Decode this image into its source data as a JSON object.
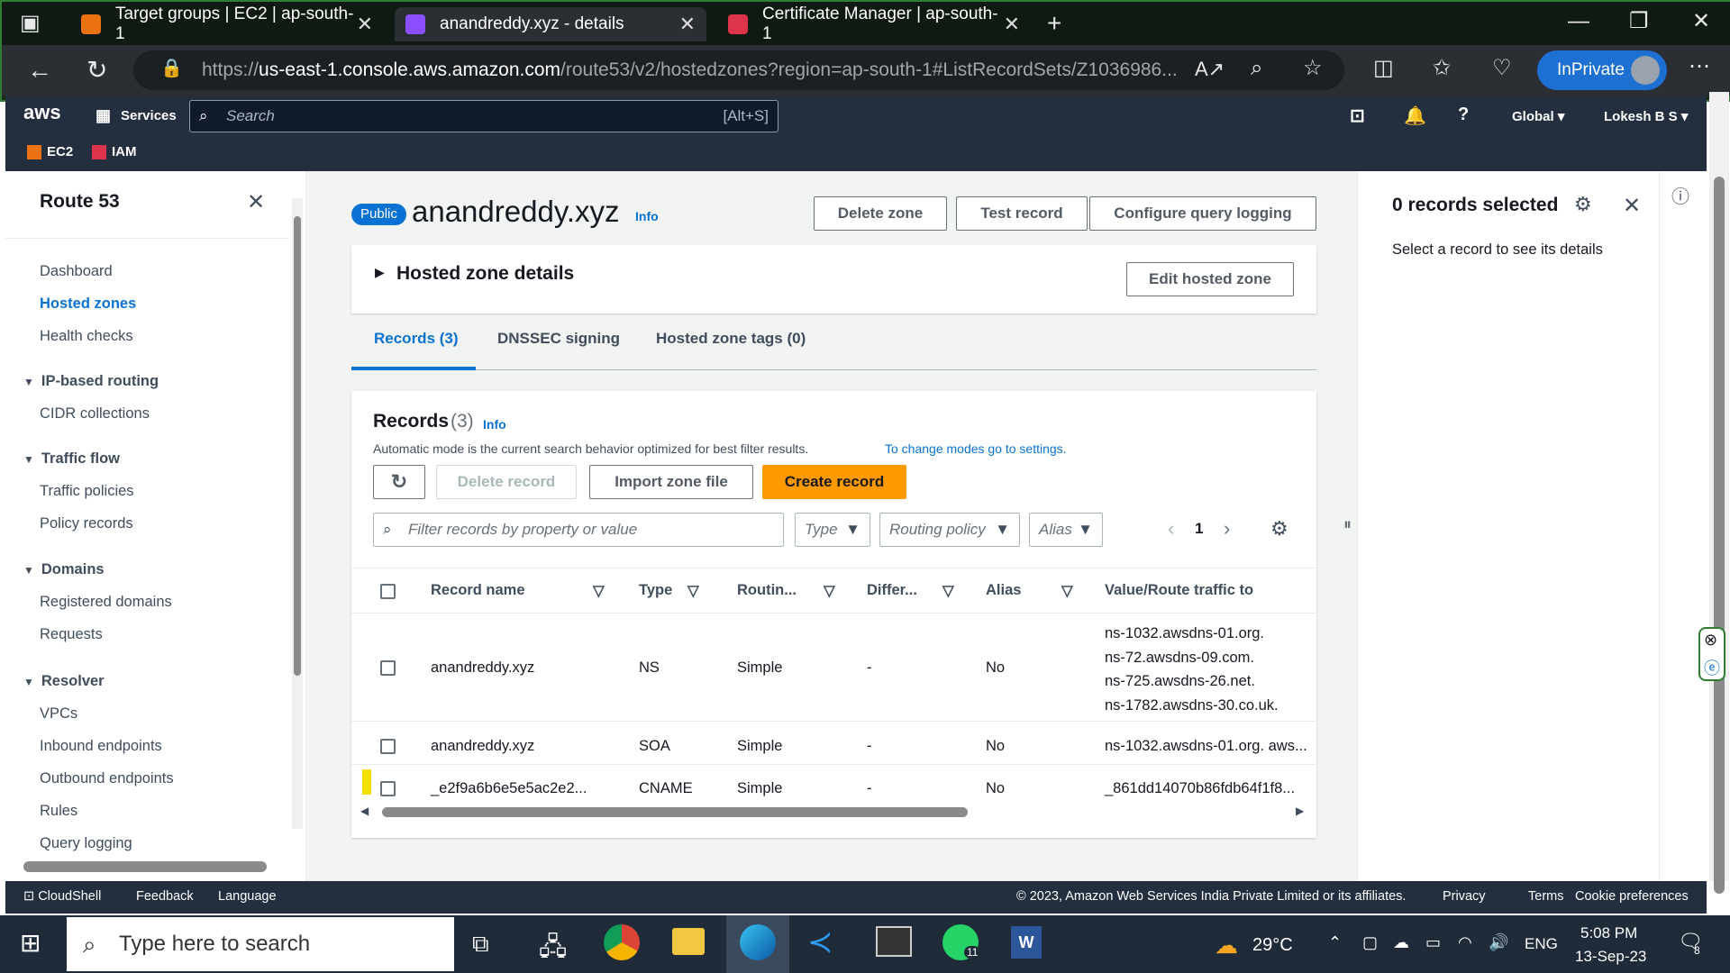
{
  "browser": {
    "tabs": [
      {
        "title": "Target groups | EC2 | ap-south-1",
        "color": "#ec7211"
      },
      {
        "title": "anandreddy.xyz - details",
        "color": "#8c4fff"
      },
      {
        "title": "Certificate Manager | ap-south-1",
        "color": "#dd344c"
      }
    ],
    "url_prefix": "https://",
    "url_host": "us-east-1.console.aws.amazon.com",
    "url_path": "/route53/v2/hostedzones?region=ap-south-1#ListRecordSets/Z1036986...",
    "inprivate": "InPrivate"
  },
  "aws_nav": {
    "logo": "aws",
    "services": "Services",
    "search_placeholder": "Search",
    "search_shortcut": "[Alt+S]",
    "region": "Global",
    "user": "Lokesh B S",
    "favorites": [
      "EC2",
      "IAM"
    ]
  },
  "sidebar": {
    "title": "Route 53",
    "items": [
      {
        "label": "Dashboard"
      },
      {
        "label": "Hosted zones",
        "active": true
      },
      {
        "label": "Health checks"
      }
    ],
    "sections": [
      {
        "title": "IP-based routing",
        "items": [
          "CIDR collections"
        ]
      },
      {
        "title": "Traffic flow",
        "items": [
          "Traffic policies",
          "Policy records"
        ]
      },
      {
        "title": "Domains",
        "items": [
          "Registered domains",
          "Requests"
        ]
      },
      {
        "title": "Resolver",
        "items": [
          "VPCs",
          "Inbound endpoints",
          "Outbound endpoints",
          "Rules",
          "Query logging"
        ]
      }
    ]
  },
  "header": {
    "badge": "Public",
    "zone_name": "anandreddy.xyz",
    "info": "Info",
    "delete_zone": "Delete zone",
    "test_record": "Test record",
    "configure_logging": "Configure query logging",
    "details_title": "Hosted zone details",
    "edit_zone": "Edit hosted zone"
  },
  "tabs": [
    "Records (3)",
    "DNSSEC signing",
    "Hosted zone tags (0)"
  ],
  "records": {
    "title": "Records",
    "count": "(3)",
    "info": "Info",
    "description": "Automatic mode is the current search behavior optimized for best filter results.",
    "settings_link": "To change modes go to settings.",
    "delete_record": "Delete record",
    "import_zone": "Import zone file",
    "create_record": "Create record",
    "filter_placeholder": "Filter records by property or value",
    "type_filter": "Type",
    "routing_filter": "Routing policy",
    "alias_filter": "Alias",
    "page": "1",
    "columns": [
      "Record name",
      "Type",
      "Routin...",
      "Differ...",
      "Alias",
      "Value/Route traffic to"
    ],
    "rows": [
      {
        "name": "anandreddy.xyz",
        "type": "NS",
        "routing": "Simple",
        "differ": "-",
        "alias": "No",
        "values": [
          "ns-1032.awsdns-01.org.",
          "ns-72.awsdns-09.com.",
          "ns-725.awsdns-26.net.",
          "ns-1782.awsdns-30.co.uk."
        ]
      },
      {
        "name": "anandreddy.xyz",
        "type": "SOA",
        "routing": "Simple",
        "differ": "-",
        "alias": "No",
        "values": [
          "ns-1032.awsdns-01.org. aws..."
        ]
      },
      {
        "name": "_e2f9a6b6e5e5ac2e2...",
        "type": "CNAME",
        "routing": "Simple",
        "differ": "-",
        "alias": "No",
        "values": [
          "_861dd14070b86fdb64f1f8..."
        ]
      }
    ]
  },
  "right_panel": {
    "title": "0 records selected",
    "subtitle": "Select a record to see its details"
  },
  "footer": {
    "cloudshell": "CloudShell",
    "feedback": "Feedback",
    "language": "Language",
    "copyright": "© 2023, Amazon Web Services India Private Limited or its affiliates.",
    "privacy": "Privacy",
    "terms": "Terms",
    "cookies": "Cookie preferences"
  },
  "taskbar": {
    "search_placeholder": "Type here to search",
    "temperature": "29°C",
    "language": "ENG",
    "time": "5:08 PM",
    "date": "13-Sep-23",
    "whatsapp_badge": "11",
    "notification_count": "8"
  },
  "colors": {
    "accent": "#0972d3",
    "orange": "#ff9900",
    "aws_nav": "#232f3e"
  }
}
